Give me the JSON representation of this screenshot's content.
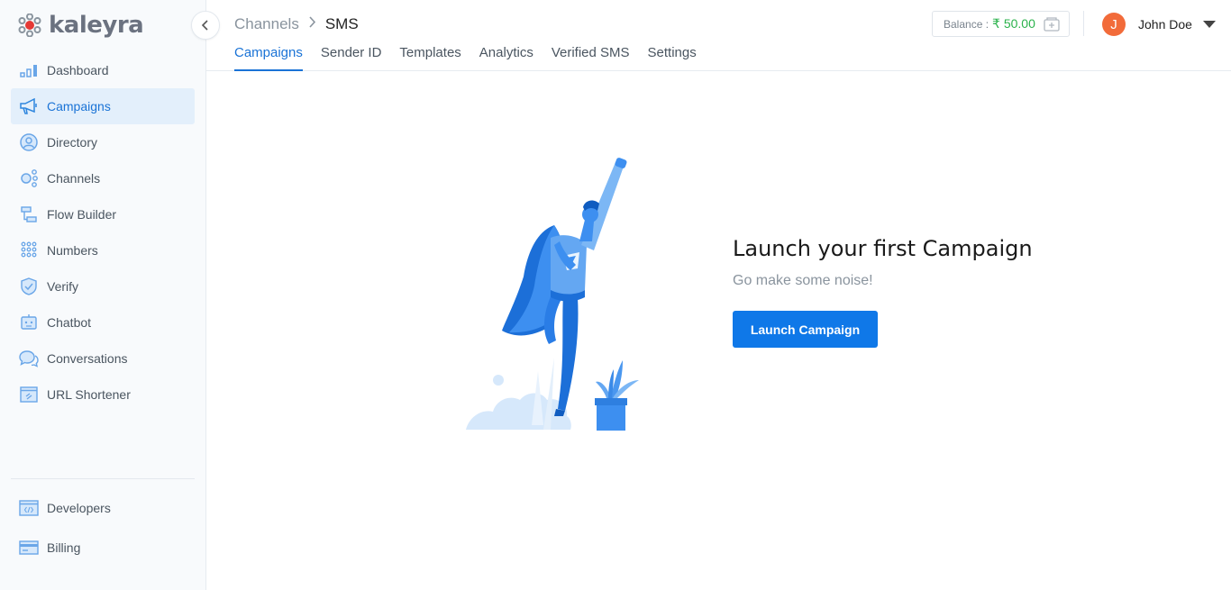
{
  "brand": {
    "name": "kaleyra",
    "logo_color": "#e53935"
  },
  "sidebar": {
    "items": [
      {
        "label": "Dashboard",
        "icon": "bar-chart-icon"
      },
      {
        "label": "Campaigns",
        "icon": "megaphone-icon",
        "active": true
      },
      {
        "label": "Directory",
        "icon": "person-circle-icon"
      },
      {
        "label": "Channels",
        "icon": "share-nodes-icon"
      },
      {
        "label": "Flow Builder",
        "icon": "flow-icon"
      },
      {
        "label": "Numbers",
        "icon": "dialpad-icon"
      },
      {
        "label": "Verify",
        "icon": "shield-check-icon"
      },
      {
        "label": "Chatbot",
        "icon": "chatbot-icon"
      },
      {
        "label": "Conversations",
        "icon": "chat-bubbles-icon"
      },
      {
        "label": "URL Shortener",
        "icon": "link-window-icon"
      }
    ],
    "bottom_items": [
      {
        "label": "Developers",
        "icon": "code-window-icon"
      },
      {
        "label": "Billing",
        "icon": "card-icon"
      }
    ]
  },
  "header": {
    "breadcrumb": {
      "parent": "Channels",
      "current": "SMS"
    },
    "tabs": [
      {
        "label": "Campaigns",
        "active": true
      },
      {
        "label": "Sender ID"
      },
      {
        "label": "Templates"
      },
      {
        "label": "Analytics"
      },
      {
        "label": "Verified SMS"
      },
      {
        "label": "Settings"
      }
    ],
    "balance": {
      "label": "Balance :",
      "amount": "₹ 50.00",
      "amount_color": "#2bb24c"
    },
    "user": {
      "initial": "J",
      "name": "John Doe",
      "avatar_color": "#f26b3a"
    }
  },
  "empty_state": {
    "title": "Launch your first Campaign",
    "subtitle": "Go make some noise!",
    "button_label": "Launch Campaign",
    "accent": "#0f78e8"
  }
}
